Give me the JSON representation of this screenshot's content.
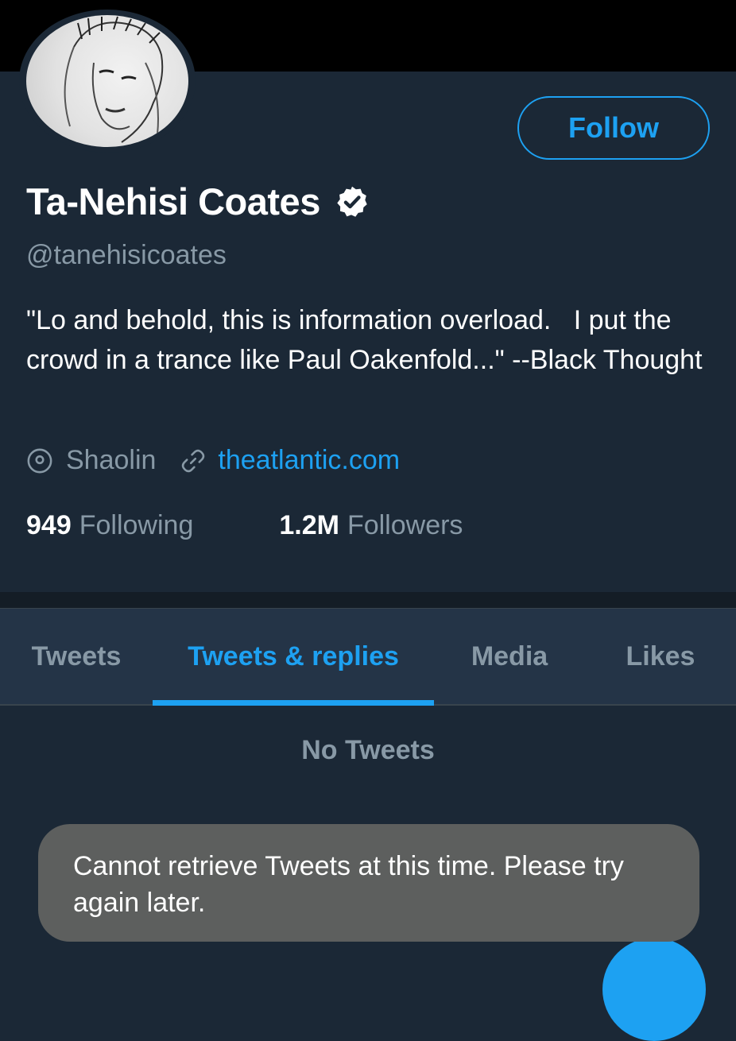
{
  "profile": {
    "display_name": "Ta-Nehisi Coates",
    "handle": "@tanehisicoates",
    "bio": "\"Lo and behold, this is information overload.   I put the crowd in a trance like Paul Oakenfold...\" --Black Thought",
    "location": "Shaolin",
    "website": "theatlantic.com",
    "verified_icon": "verified-badge-icon",
    "follow_label": "Follow"
  },
  "stats": {
    "following_count": "949",
    "following_label": "Following",
    "followers_count": "1.2M",
    "followers_label": "Followers"
  },
  "tabs": [
    {
      "label": "Tweets",
      "active": false
    },
    {
      "label": "Tweets & replies",
      "active": true
    },
    {
      "label": "Media",
      "active": false
    },
    {
      "label": "Likes",
      "active": false
    }
  ],
  "timeline": {
    "empty_label": "No Tweets"
  },
  "toast": {
    "message": "Cannot retrieve Tweets at this time. Please try again later."
  },
  "colors": {
    "background": "#1b2836",
    "accent": "#1da1f2",
    "secondary_text": "#8899a6",
    "tab_bar": "#243447",
    "toast": "#5d5f5e"
  }
}
